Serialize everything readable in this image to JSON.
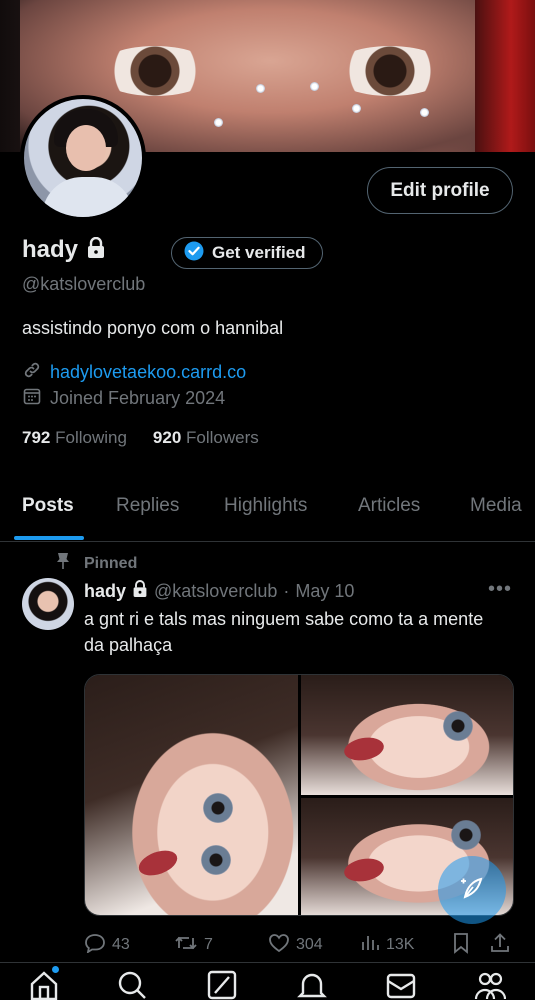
{
  "profile": {
    "name": "hady",
    "handle": "@katsloverclub",
    "bio": "assistindo ponyo com o hannibal",
    "link": "hadylovetaekoo.carrd.co",
    "joined": "Joined February 2024",
    "following_count": "792",
    "following_label": "Following",
    "followers_count": "920",
    "followers_label": "Followers",
    "edit_profile_label": "Edit profile",
    "get_verified_label": "Get verified"
  },
  "tabs": [
    {
      "label": "Posts",
      "active": true
    },
    {
      "label": "Replies"
    },
    {
      "label": "Highlights"
    },
    {
      "label": "Articles"
    },
    {
      "label": "Media"
    }
  ],
  "pinned_post": {
    "pinned_label": "Pinned",
    "author": "hady",
    "handle": "@katsloverclub",
    "separator": "·",
    "date": "May 10",
    "text": "a gnt ri e tals mas ninguem sabe como ta a mente da palhaça",
    "more_icon": "more-horizontal-icon",
    "replies": "43",
    "reposts": "7",
    "likes": "304",
    "views": "13K"
  },
  "bottom_nav": {
    "items": [
      "home-icon",
      "search-icon",
      "grok-icon",
      "notifications-icon",
      "messages-icon",
      "communities-icon"
    ]
  },
  "colors": {
    "accent": "#1d9bf0",
    "background": "#000000",
    "text": "#e7e9ea",
    "muted": "#71767b",
    "border": "#2f3336"
  }
}
